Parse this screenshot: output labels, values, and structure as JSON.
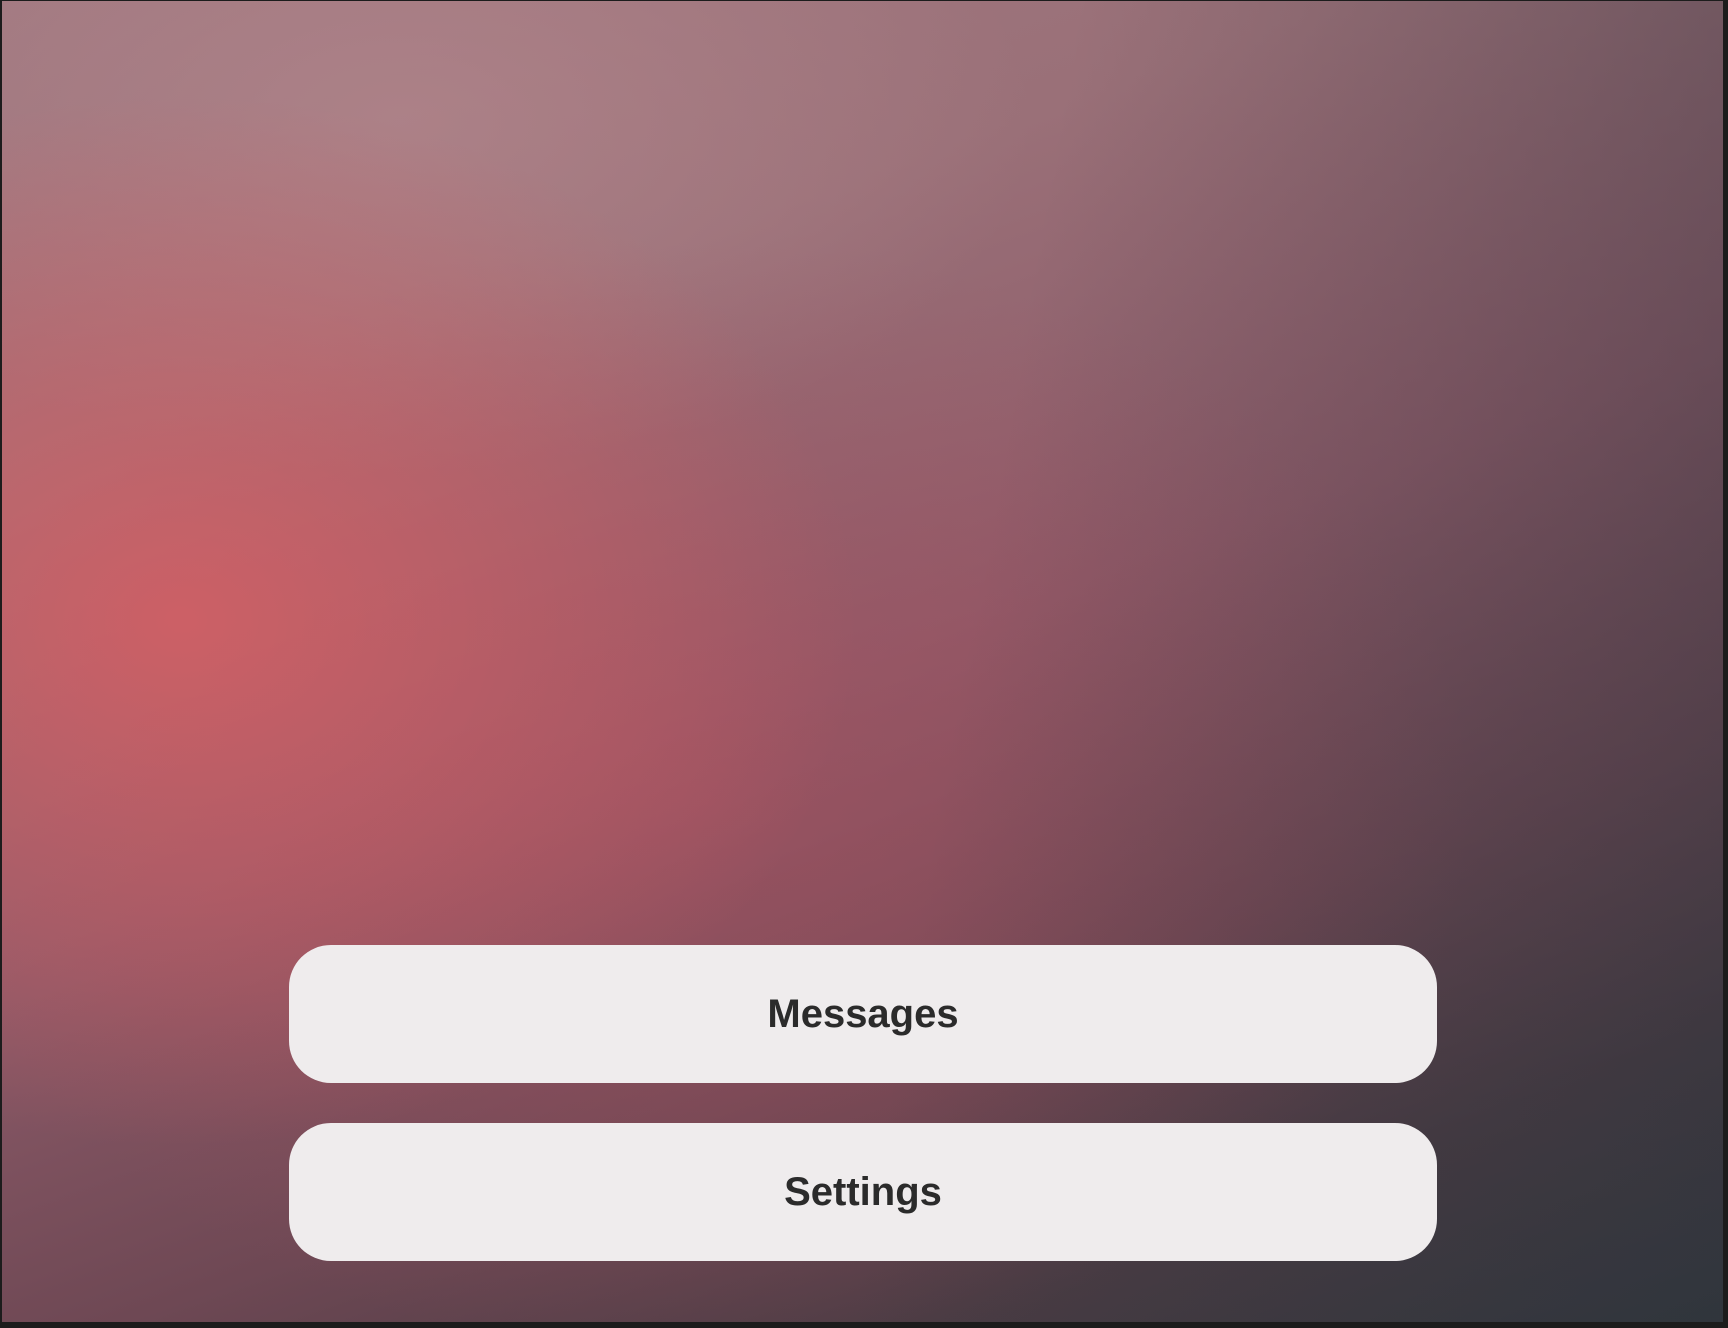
{
  "menu": {
    "messages_label": "Messages",
    "settings_label": "Settings"
  },
  "colors": {
    "button_background": "#efeced",
    "button_text": "#2b2b2b",
    "wallpaper_accent": "#d65f64"
  }
}
